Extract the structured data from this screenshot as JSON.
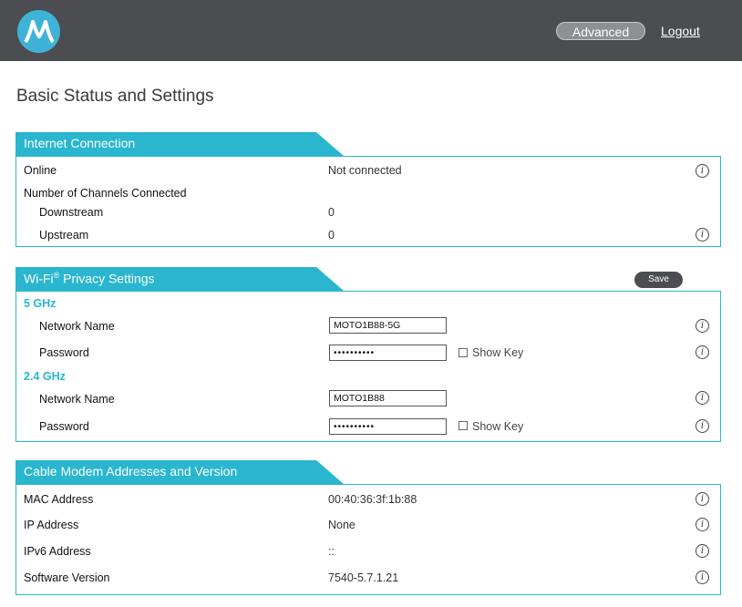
{
  "header": {
    "logo_label": "Motorola logo",
    "advanced_label": "Advanced",
    "logout_label": "Logout"
  },
  "page_title": "Basic Status and Settings",
  "internet": {
    "title": "Internet Connection",
    "online_label": "Online",
    "online_value": "Not connected",
    "channels_label": "Number of Channels Connected",
    "downstream_label": "Downstream",
    "downstream_value": "0",
    "upstream_label": "Upstream",
    "upstream_value": "0"
  },
  "wifi": {
    "title": "Wi-Fi",
    "title_sup": "®",
    "title_suffix": " Privacy Settings",
    "save_label": "Save",
    "band5": {
      "band_label": "5 GHz",
      "network_name_label": "Network Name",
      "network_name_value": "MOTO1B88-5G",
      "password_label": "Password",
      "password_value": "••••••••••",
      "show_key_label": "Show Key"
    },
    "band24": {
      "band_label": "2.4 GHz",
      "network_name_label": "Network Name",
      "network_name_value": "MOTO1B88",
      "password_label": "Password",
      "password_value": "••••••••••",
      "show_key_label": "Show Key"
    }
  },
  "modem": {
    "title": "Cable Modem Addresses and Version",
    "mac_label": "MAC Address",
    "mac_value": "00:40:36:3f:1b:88",
    "ip_label": "IP Address",
    "ip_value": "None",
    "ipv6_label": "IPv6 Address",
    "ipv6_value": "::",
    "sw_label": "Software Version",
    "sw_value": "7540-5.7.1.21"
  },
  "colors": {
    "accent": "#29b6ce",
    "topbar": "#4b4d50",
    "logo": "#3fb3d7"
  },
  "icons": {
    "logo": "motorola-m-logo",
    "info": "info-icon"
  }
}
